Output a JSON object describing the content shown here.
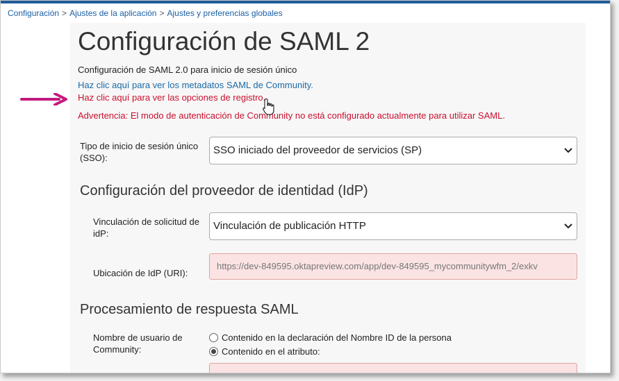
{
  "breadcrumb": {
    "items": [
      "Configuración",
      "Ajustes de la aplicación",
      "Ajustes y preferencias globales"
    ]
  },
  "page": {
    "title": "Configuración de SAML 2",
    "subtitle": "Configuración de SAML 2.0 para inicio de sesión único",
    "metadata_link": "Haz clic aquí para ver los metadatos SAML de Community.",
    "log_link": "Haz clic aquí para ver las opciones de registro.",
    "warning": "Advertencia: El modo de autenticación de Community no está configurado actualmente para utilizar SAML."
  },
  "sso": {
    "label": "Tipo de inicio de sesión único (SSO):",
    "selected": "SSO iniciado del proveedor de servicios (SP)"
  },
  "idp": {
    "heading": "Configuración del proveedor de identidad (IdP)",
    "binding_label": "Vinculación de solicitud de idP:",
    "binding_selected": "Vinculación de publicación HTTP",
    "location_label": "Ubicación de IdP (URI):",
    "location_value": "https://dev-849595.oktapreview.com/app/dev-849595_mycommunitywfm_2/exkv"
  },
  "response": {
    "heading": "Procesamiento de respuesta SAML",
    "username_label": "Nombre de usuario de Community:",
    "options": [
      "Contenido en la declaración del Nombre ID de la persona",
      "Contenido en el atributo:"
    ],
    "selected_index": 1
  },
  "colors": {
    "link": "#1a6aa8",
    "warning": "#c8102e",
    "arrow": "#c21a7e",
    "invalid_field": "#fbe3e3"
  },
  "icons": [
    "arrow-right-icon",
    "hand-pointer-icon",
    "chevron-down-icon"
  ]
}
